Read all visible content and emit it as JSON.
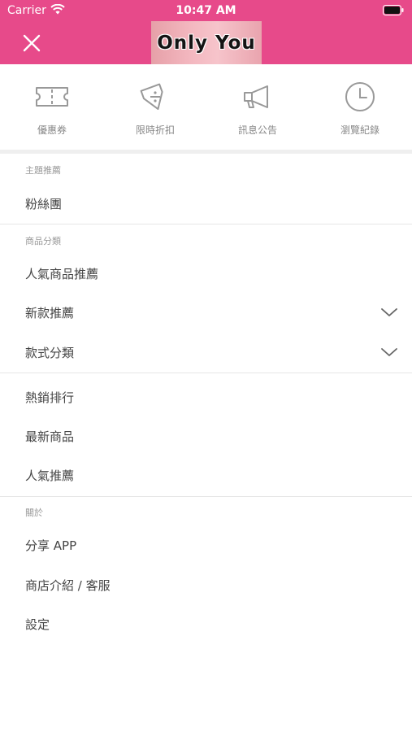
{
  "status_bar": {
    "carrier": "Carrier",
    "time": "10:47 AM"
  },
  "header": {
    "logo_text": "Only You",
    "brand_color": "#e74a8a"
  },
  "quick_links": [
    {
      "label": "優惠券",
      "icon": "ticket-icon"
    },
    {
      "label": "限時折扣",
      "icon": "discount-tag-icon"
    },
    {
      "label": "訊息公告",
      "icon": "megaphone-icon"
    },
    {
      "label": "瀏覽紀錄",
      "icon": "clock-icon"
    }
  ],
  "sections": {
    "theme": {
      "title": "主題推薦",
      "items": [
        "粉絲團"
      ]
    },
    "category": {
      "title": "商品分類",
      "items": [
        "人氣商品推薦",
        "新款推薦",
        "款式分類"
      ]
    },
    "ranking": {
      "items": [
        "熱銷排行",
        "最新商品",
        "人氣推薦"
      ]
    },
    "about": {
      "title": "關於",
      "items": [
        "分享 APP",
        "商店介紹 / 客服",
        "設定"
      ]
    }
  }
}
